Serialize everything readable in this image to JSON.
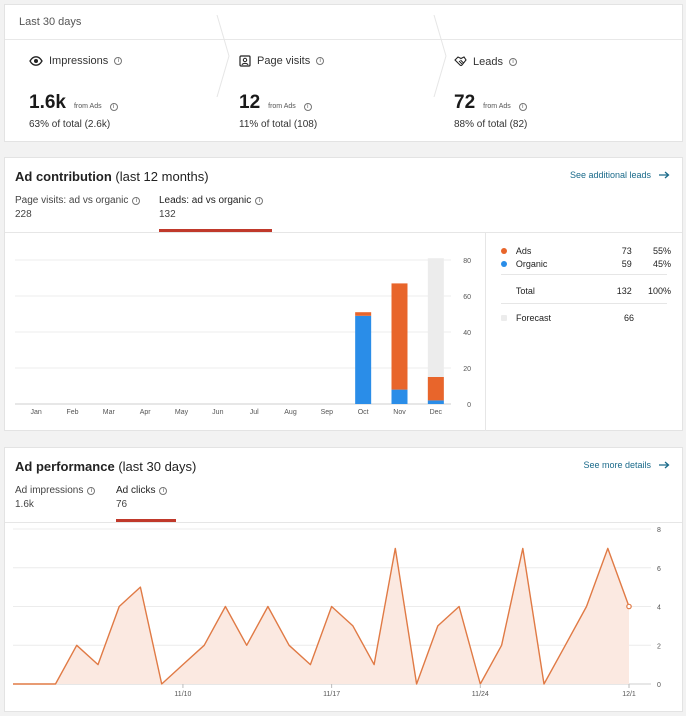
{
  "summary": {
    "period": "Last 30 days",
    "metrics": [
      {
        "label": "Impressions",
        "value": "1.6k",
        "from": "from Ads",
        "pct": "63% of total (2.6k)"
      },
      {
        "label": "Page visits",
        "value": "12",
        "from": "from Ads",
        "pct": "11% of total (108)"
      },
      {
        "label": "Leads",
        "value": "72",
        "from": "from Ads",
        "pct": "88% of total (82)"
      }
    ]
  },
  "contribution": {
    "title": "Ad contribution",
    "subtitle": "(last 12 months)",
    "link": "See additional leads",
    "tabs": [
      {
        "label": "Page visits: ad vs organic",
        "value": "228"
      },
      {
        "label": "Leads: ad vs organic",
        "value": "132"
      }
    ],
    "active_tab": 1,
    "legend": {
      "rows": [
        {
          "name": "Ads",
          "value": "73",
          "pct": "55%",
          "color": "#e8652b"
        },
        {
          "name": "Organic",
          "value": "59",
          "pct": "45%",
          "color": "#2a8de8"
        }
      ],
      "total": {
        "name": "Total",
        "value": "132",
        "pct": "100%"
      },
      "forecast": {
        "name": "Forecast",
        "value": "66",
        "color": "#ececec"
      }
    }
  },
  "performance": {
    "title": "Ad performance",
    "subtitle": "(last 30 days)",
    "link": "See more details",
    "tabs": [
      {
        "label": "Ad impressions",
        "value": "1.6k"
      },
      {
        "label": "Ad clicks",
        "value": "76"
      }
    ],
    "active_tab": 1
  },
  "chart_data": [
    {
      "type": "bar",
      "stacked": true,
      "categories": [
        "Jan",
        "Feb",
        "Mar",
        "Apr",
        "May",
        "Jun",
        "Jul",
        "Aug",
        "Sep",
        "Oct",
        "Nov",
        "Dec"
      ],
      "series": [
        {
          "name": "Organic",
          "color": "#2a8de8",
          "values": [
            0,
            0,
            0,
            0,
            0,
            0,
            0,
            0,
            0,
            49,
            8,
            2
          ]
        },
        {
          "name": "Ads",
          "color": "#e8652b",
          "values": [
            0,
            0,
            0,
            0,
            0,
            0,
            0,
            0,
            0,
            2,
            59,
            13
          ]
        }
      ],
      "forecast": {
        "name": "Forecast",
        "color": "#ececec",
        "values": [
          0,
          0,
          0,
          0,
          0,
          0,
          0,
          0,
          0,
          0,
          0,
          81
        ]
      },
      "yticks": [
        0,
        20,
        40,
        60,
        80
      ],
      "ylim": [
        0,
        80
      ],
      "y_axis_side": "right",
      "grid": true
    },
    {
      "type": "area",
      "color": "#e07a45",
      "fill": "#fbe9e1",
      "x": [
        "11/2",
        "11/3",
        "11/4",
        "11/5",
        "11/6",
        "11/7",
        "11/8",
        "11/9",
        "11/10",
        "11/11",
        "11/12",
        "11/13",
        "11/14",
        "11/15",
        "11/16",
        "11/17",
        "11/18",
        "11/19",
        "11/20",
        "11/21",
        "11/22",
        "11/23",
        "11/24",
        "11/25",
        "11/26",
        "11/27",
        "11/28",
        "11/29",
        "11/30",
        "12/1",
        "12/2",
        "12/3"
      ],
      "values": [
        0,
        0,
        0,
        2,
        1,
        4,
        5,
        0,
        1,
        2,
        4,
        2,
        4,
        2,
        1,
        4,
        3,
        1,
        7,
        0,
        3,
        4,
        0,
        2,
        7,
        0,
        2,
        4,
        7,
        4
      ],
      "xticks": [
        "11/10",
        "11/17",
        "11/24",
        "12/1"
      ],
      "yticks": [
        0,
        2,
        4,
        6,
        8
      ],
      "ylim": [
        0,
        8
      ],
      "y_axis_side": "right",
      "grid": true
    }
  ]
}
